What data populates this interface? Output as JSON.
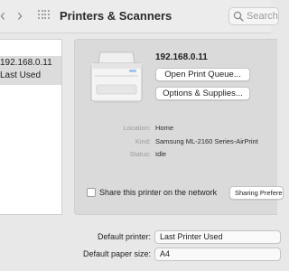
{
  "window": {
    "title": "Printers & Scanners",
    "back_glyph": "‹",
    "forward_glyph": "›",
    "search_placeholder": "Search",
    "icons": [
      "chevron-left-icon",
      "chevron-right-icon",
      "grid-icon",
      "search-icon"
    ]
  },
  "sidebar": {
    "items": [
      {
        "name": "192.168.0.11",
        "status": "Last Used",
        "selected": true
      }
    ]
  },
  "detail": {
    "printer_name": "192.168.0.11",
    "open_queue_label": "Open Print Queue...",
    "options_label": "Options & Supplies...",
    "location_label": "Location:",
    "location_value": "Home",
    "kind_label": "Kind:",
    "kind_value": "Samsung ML-2160 Series-AirPrint",
    "status_label": "Status:",
    "status_value": "Idle",
    "share_label": "Share this printer on the network",
    "share_checked": false,
    "sharing_prefs_label": "Sharing Preferences..."
  },
  "defaults": {
    "printer_label": "Default printer:",
    "printer_value": "Last Printer Used",
    "paper_label": "Default paper size:",
    "paper_value": "A4"
  },
  "colors": {
    "window_bg": "#e8e8e8",
    "sidebar_bg": "#ffffff",
    "selected_row": "#dcdcdc",
    "detail_bg": "#dadada"
  }
}
